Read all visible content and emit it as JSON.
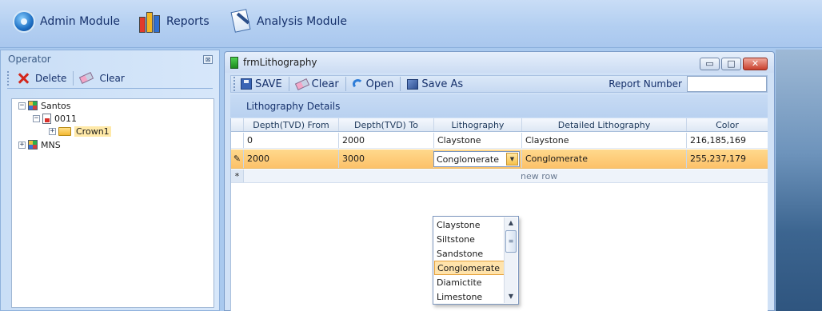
{
  "menu": {
    "items": [
      {
        "label": "Admin Module",
        "icon": "admin-gear-icon"
      },
      {
        "label": "Reports",
        "icon": "bar-chart-icon"
      },
      {
        "label": "Analysis Module",
        "icon": "analysis-doc-icon"
      }
    ]
  },
  "operator": {
    "title": "Operator",
    "close_glyph": "⊠",
    "toolbar": {
      "delete_label": "Delete",
      "clear_label": "Clear"
    },
    "tree": {
      "root1": {
        "label": "Santos",
        "expander": "−"
      },
      "child1": {
        "label": "0011",
        "expander": "−"
      },
      "leaf1": {
        "label": "Crown1",
        "expander": "+"
      },
      "root2": {
        "label": "MNS",
        "expander": "+"
      }
    }
  },
  "window": {
    "title": "frmLithography",
    "controls": {
      "minimize": "▭",
      "maximize": "□",
      "close": "✕"
    },
    "toolbar": {
      "save_label": "SAVE",
      "clear_label": "Clear",
      "open_label": "Open",
      "saveas_label": "Save As",
      "report_number_label": "Report Number",
      "report_number_value": ""
    },
    "section_title": "Lithography Details"
  },
  "grid": {
    "columns": [
      "Depth(TVD) From",
      "Depth(TVD) To",
      "Lithography",
      "Detailed Lithography",
      "Color"
    ],
    "rows": [
      {
        "indicator": "",
        "from": "0",
        "to": "2000",
        "lithography": "Claystone",
        "detailed": "Claystone",
        "color": "216,185,169"
      },
      {
        "indicator": "✎",
        "from": "2000",
        "to": "3000",
        "lithography": "Conglomerate",
        "detailed": "Conglomerate",
        "color": "255,237,179"
      }
    ],
    "new_row": {
      "indicator": "*",
      "text": "new row"
    }
  },
  "combo": {
    "value": "Conglomerate",
    "options": [
      "Claystone",
      "Siltstone",
      "Sandstone",
      "Conglomerate",
      "Diamictite",
      "Limestone"
    ],
    "selected_index": 3
  }
}
